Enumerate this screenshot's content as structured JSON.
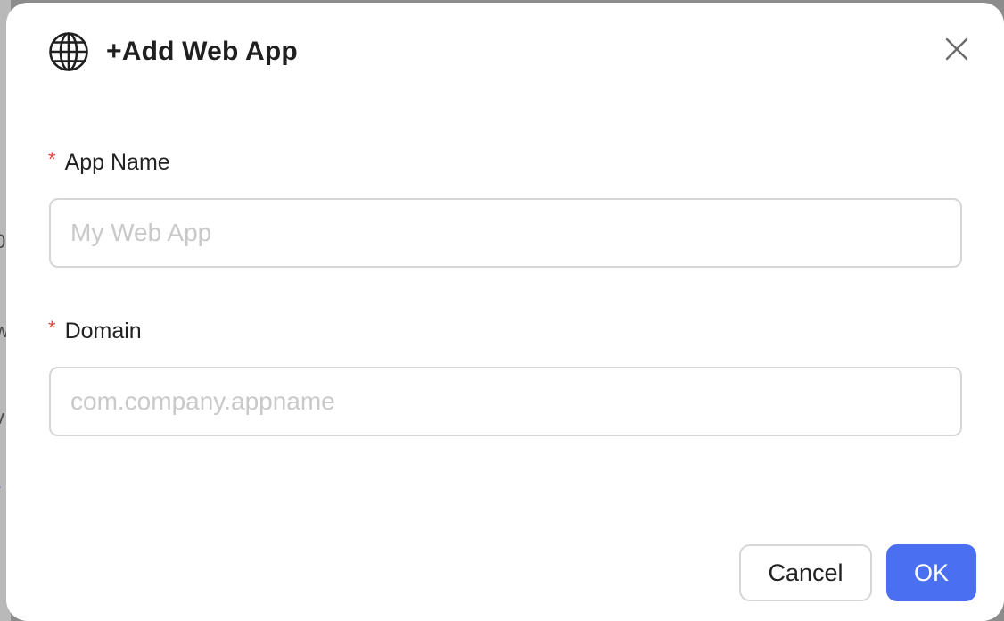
{
  "background": {
    "fragments": [
      "0",
      "w",
      "v",
      "-"
    ]
  },
  "dialog": {
    "title": "+Add Web App",
    "title_icon": "globe-icon",
    "close_icon": "close-icon",
    "fields": [
      {
        "label": "App Name",
        "required_mark": "*",
        "value": "",
        "placeholder": "My Web App"
      },
      {
        "label": "Domain",
        "required_mark": "*",
        "value": "",
        "placeholder": "com.company.appname"
      }
    ],
    "buttons": {
      "cancel_label": "Cancel",
      "ok_label": "OK"
    }
  },
  "colors": {
    "primary": "#4a6ff0",
    "required": "#e0443e",
    "border": "#d6d6d6",
    "placeholder": "#c9c9c9"
  }
}
